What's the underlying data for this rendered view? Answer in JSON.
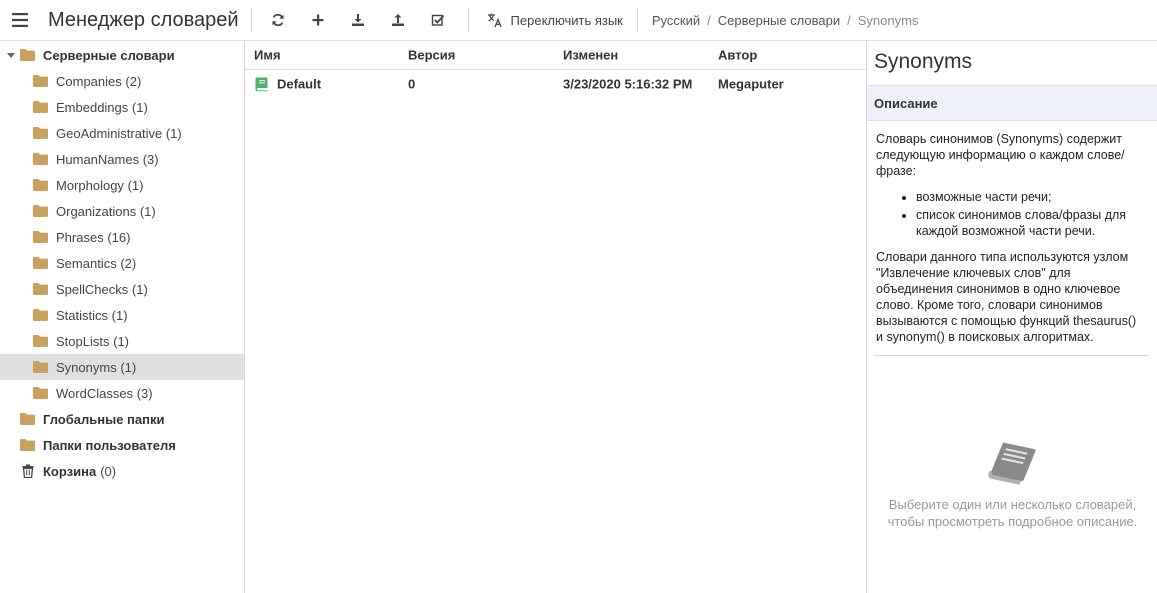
{
  "app": {
    "title": "Менеджер словарей"
  },
  "toolbar": {
    "switch_language_label": "Переключить язык"
  },
  "breadcrumb": [
    "Русский",
    "Серверные словари",
    "Synonyms"
  ],
  "tree": {
    "root": {
      "label": "Серверные словари"
    },
    "children": [
      {
        "label": "Companies",
        "count": "(2)"
      },
      {
        "label": "Embeddings",
        "count": "(1)"
      },
      {
        "label": "GeoAdministrative",
        "count": "(1)"
      },
      {
        "label": "HumanNames",
        "count": "(3)"
      },
      {
        "label": "Morphology",
        "count": "(1)"
      },
      {
        "label": "Organizations",
        "count": "(1)"
      },
      {
        "label": "Phrases",
        "count": "(16)"
      },
      {
        "label": "Semantics",
        "count": "(2)"
      },
      {
        "label": "SpellChecks",
        "count": "(1)"
      },
      {
        "label": "Statistics",
        "count": "(1)"
      },
      {
        "label": "StopLists",
        "count": "(1)"
      },
      {
        "label": "Synonyms",
        "count": "(1)"
      },
      {
        "label": "WordClasses",
        "count": "(3)"
      }
    ],
    "global_folders": "Глобальные папки",
    "user_folders": "Папки пользователя",
    "trash": {
      "label": "Корзина",
      "count": "(0)"
    }
  },
  "table": {
    "headers": {
      "name": "Имя",
      "version": "Версия",
      "modified": "Изменен",
      "author": "Автор"
    },
    "rows": [
      {
        "name": "Default",
        "version": "0",
        "modified": "3/23/2020 5:16:32 PM",
        "author": "Megaputer"
      }
    ]
  },
  "details": {
    "title": "Synonyms",
    "section_label": "Описание",
    "intro": "Словарь синонимов (Synonyms) содержит следующую информацию о каждом слове/фразе:",
    "bullets": [
      "возможные части речи;",
      "список синонимов слова/фразы для каждой возможной части речи."
    ],
    "usage": "Словари данного типа используются узлом \"Извлечение ключевых слов\" для объединения синонимов в одно ключевое слово. Кроме того, словари синонимов вызываются с помощью функций thesaurus() и synonym() в поисковых алгоритмах.",
    "empty_hint_line1": "Выберите один или несколько словарей,",
    "empty_hint_line2": "чтобы просмотреть подробное описание."
  },
  "colors": {
    "folder": "#c8a15e",
    "book": "#4caf6a",
    "selected_row": "#e0e0e0",
    "section_bg": "#eef2f8"
  }
}
